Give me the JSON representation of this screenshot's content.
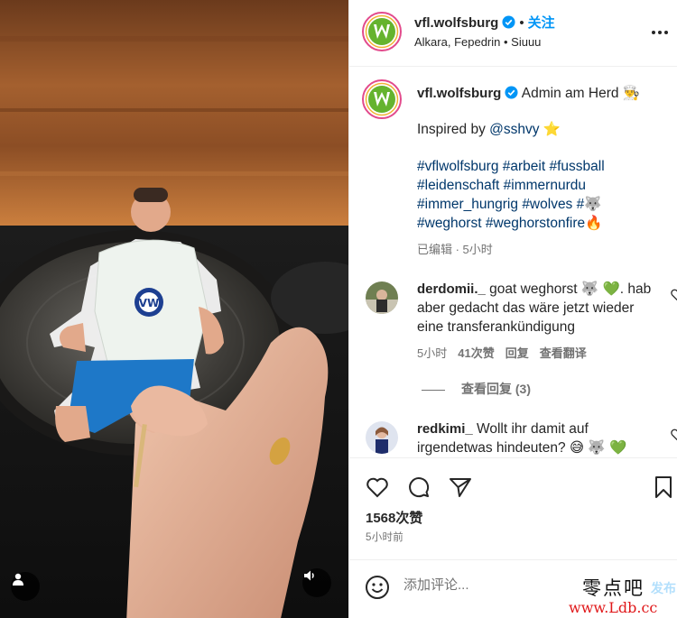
{
  "header": {
    "username": "vfl.wolfsburg",
    "dot": "•",
    "follow_label": "关注",
    "audio_line": "Alkara, Fepedrin • Siuuu"
  },
  "caption": {
    "username": "vfl.wolfsburg",
    "text": "Admin am Herd 👨‍🍳",
    "inspired_prefix": "Inspired by ",
    "inspired_handle": "@sshvy",
    "inspired_emoji": "⭐",
    "hashtags": [
      "#vflwolfsburg",
      "#arbeit",
      "#fussball",
      "#leidenschaft",
      "#immernurdu",
      "#immer_hungrig",
      "#wolves",
      "#🐺",
      "#weghorst",
      "#weghorstonfire🔥"
    ],
    "meta": "已编辑 · 5小时"
  },
  "comments": [
    {
      "username": "derdomii._",
      "text": "goat weghorst 🐺 💚. hab aber gedacht das wäre jetzt wieder eine transferankündigung",
      "time": "5小时",
      "likes": "41次赞",
      "reply_label": "回复",
      "translate_label": "查看翻译",
      "view_replies": "查看回复 (3)"
    },
    {
      "username": "redkimi_",
      "text": "Wollt ihr damit auf irgendetwas hindeuten? 😅 🐺 💚"
    }
  ],
  "actions": {
    "likes": "1568次赞",
    "time": "5小时前"
  },
  "add_comment": {
    "placeholder": "添加评论...",
    "post_label": "发布"
  },
  "watermark": {
    "line1": "零点吧",
    "line2": "www.Ldb.cc"
  },
  "colors": {
    "accent_blue": "#0095f6",
    "link_blue": "#00376b",
    "wolfsburg_green": "#65b32e",
    "verified_blue": "#0095f6",
    "heart_green": "#2ecc40"
  }
}
